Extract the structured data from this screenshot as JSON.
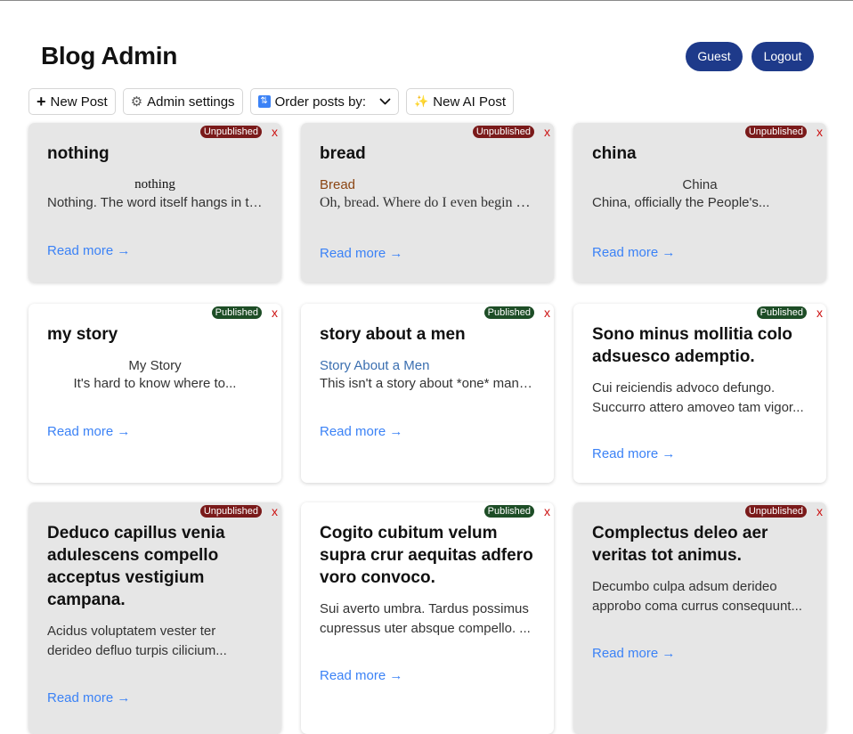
{
  "header": {
    "title": "Blog Admin",
    "guest_label": "Guest",
    "logout_label": "Logout"
  },
  "toolbar": {
    "new_post_label": "New Post",
    "admin_settings_label": "Admin settings",
    "order_label": "Order posts by:",
    "new_ai_post_label": "New AI Post"
  },
  "colors": {
    "accent": "#1e3a8a",
    "link": "#3b82f6",
    "unpublished_badge": "#7a1a1a",
    "published_badge": "#1d4d26",
    "delete": "#cc1111",
    "card_gray": "#e6e6e6"
  },
  "icons": [
    "plus-icon",
    "gear-icon",
    "sort-icon",
    "chevron-down-icon",
    "sparkles-icon",
    "arrow-right-icon",
    "close-icon"
  ],
  "delete_label": "x",
  "read_more_label": "Read more →",
  "posts": [
    {
      "title": "nothing",
      "status": "Unpublished",
      "subtitle": "nothing",
      "excerpt": "Nothing. The word itself hangs in the air"
    },
    {
      "title": "bread",
      "status": "Unpublished",
      "subtitle": "Bread",
      "excerpt": "Oh, bread. Where do I even begin with"
    },
    {
      "title": "china",
      "status": "Unpublished",
      "subtitle": "China",
      "excerpt": "China, officially the People's..."
    },
    {
      "title": "my story",
      "status": "Published",
      "subtitle": "My Story",
      "excerpt": "It's hard to know where to..."
    },
    {
      "title": "story about a men",
      "status": "Published",
      "subtitle": "Story About a Men",
      "excerpt": "This isn't a story about *one* man, but"
    },
    {
      "title": "Sono minus mollitia colo adsuesco ademptio.",
      "status": "Published",
      "excerpt_lines": [
        "Cui reiciendis advoco defungo.",
        "Succurro attero amoveo tam vigor..."
      ]
    },
    {
      "title": "Deduco capillus venia adulescens compello acceptus vestigium campana.",
      "status": "Unpublished",
      "excerpt_lines": [
        "Acidus voluptatem vester ter",
        "derideo defluo turpis cilicium..."
      ]
    },
    {
      "title": "Cogito cubitum velum supra crur aequitas adfero voro convoco.",
      "status": "Published",
      "excerpt_lines": [
        "Sui averto umbra. Tardus possimus",
        "cupressus uter absque compello. ..."
      ]
    },
    {
      "title": "Complectus deleo aer veritas tot animus.",
      "status": "Unpublished",
      "excerpt_lines": [
        "Decumbo culpa adsum derideo",
        "approbo coma currus consequunt..."
      ]
    }
  ]
}
